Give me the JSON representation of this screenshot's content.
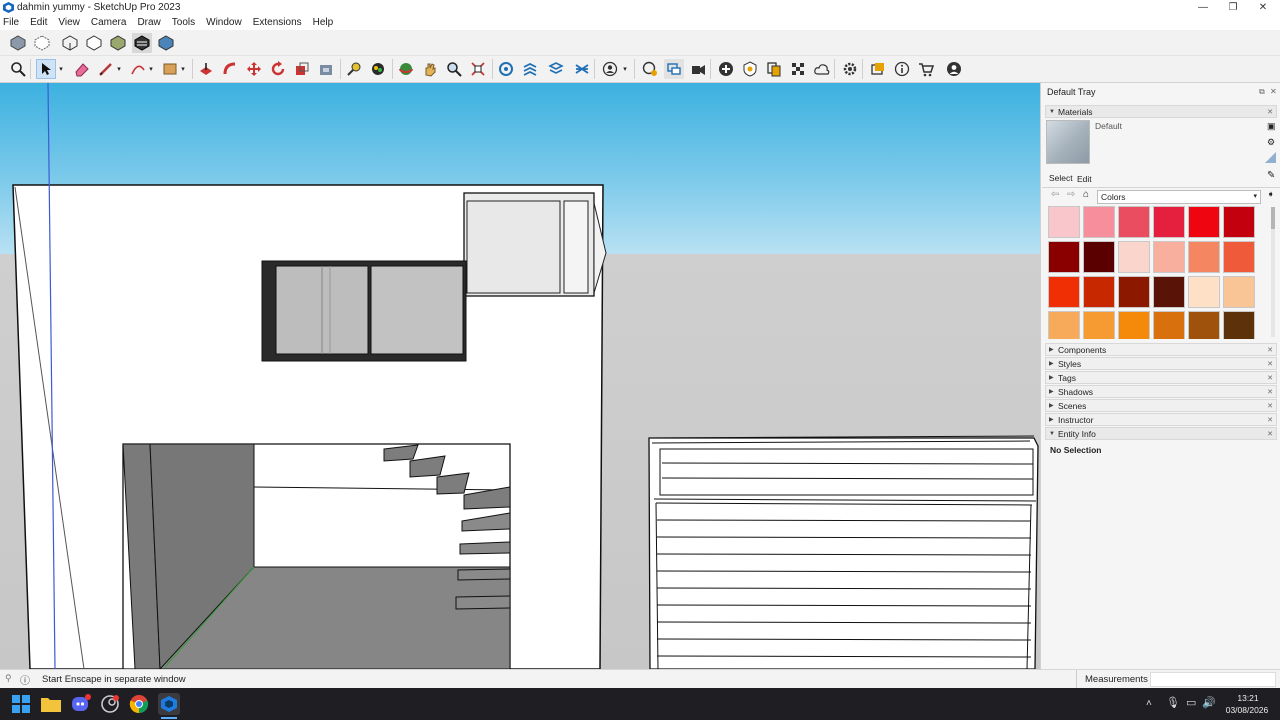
{
  "window": {
    "title": "dahmin yummy - SketchUp Pro 2023",
    "controls": {
      "minimize": "—",
      "maximize": "❐",
      "close": "✕"
    }
  },
  "menu": [
    "File",
    "Edit",
    "View",
    "Camera",
    "Draw",
    "Tools",
    "Window",
    "Extensions",
    "Help"
  ],
  "tray": {
    "title": "Default Tray",
    "materials": {
      "header": "Materials",
      "current_material": "Default",
      "tabs": [
        "Select",
        "Edit"
      ],
      "library": "Colors",
      "swatches": [
        "#f9c6cc",
        "#f78e9b",
        "#ea4d5f",
        "#e4203e",
        "#ee0510",
        "#c3000d",
        "#8a0000",
        "#5a0000",
        "#f9d5cb",
        "#f8af9e",
        "#f48662",
        "#ee5a3a",
        "#f02f05",
        "#c82800",
        "#8c1800",
        "#5a1407",
        "#fde0c6",
        "#f9c596",
        "#f7ab5a",
        "#f59b31",
        "#f58a0a",
        "#d8700e",
        "#9f520b",
        "#5d3109"
      ]
    },
    "sections": [
      "Components",
      "Styles",
      "Tags",
      "Shadows",
      "Scenes",
      "Instructor",
      "Entity Info"
    ],
    "entity_info": {
      "text": "No Selection"
    }
  },
  "status": {
    "message": "Start Enscape in separate window",
    "measurements_label": "Measurements"
  },
  "taskbar": {
    "time": "13:21",
    "date": "03/08/2026"
  },
  "colors": {
    "sky_top": "#3cb1e0",
    "ground": "#c9c9c9",
    "taskbar": "#1f1f23"
  }
}
